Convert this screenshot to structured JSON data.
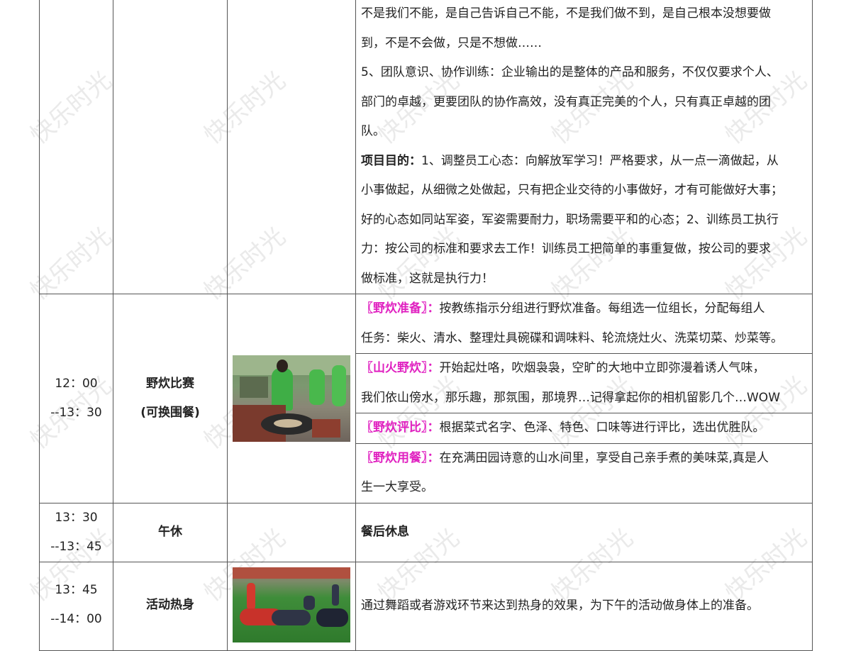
{
  "watermark": "快乐时光",
  "rows": [
    {
      "continuation": true,
      "lines": [
        {
          "segments": [
            {
              "t": "不是我们不能，是自己告诉自己不能，不是我们做不到，是自己根本没想要做"
            }
          ]
        },
        {
          "segments": [
            {
              "t": "到，不是不会做，只是不想做……"
            }
          ]
        },
        {
          "segments": [
            {
              "t": "5、团队意识、协作训练：企业输出的是整体的产品和服务，不仅仅要求个人、"
            }
          ]
        },
        {
          "segments": [
            {
              "t": "部门的卓越，更要团队的协作高效，没有真正完美的个人，只有真正卓越的团"
            }
          ]
        },
        {
          "segments": [
            {
              "t": "队。"
            }
          ]
        },
        {
          "segments": [
            {
              "t": "项目目的：",
              "b": true
            },
            {
              "t": "1、调整员工心态：向解放军学习！严格要求，从一点一滴做起，从"
            }
          ]
        },
        {
          "segments": [
            {
              "t": "小事做起，从细微之处做起，只有把企业交待的小事做好，才有可能做好大事；"
            }
          ]
        },
        {
          "segments": [
            {
              "t": "好的心态如同站军姿，军姿需要耐力，职场需要平和的心态；2、训练员工执行"
            }
          ]
        },
        {
          "segments": [
            {
              "t": "力：按公司的标准和要求去工作！训练员工把简单的事重复做，按公司的要求"
            }
          ]
        },
        {
          "segments": [
            {
              "t": "做标准，这就是执行力！"
            }
          ]
        }
      ]
    },
    {
      "time": [
        "12：00",
        "--13：30"
      ],
      "name": [
        "野炊比赛",
        "(可换围餐)"
      ],
      "image": "cooking-photo",
      "subs": [
        {
          "label": "〖野炊准备〗：",
          "lines": [
            "按教练指示分组进行野炊准备。每组选一位组长，分配每组人",
            "任务：柴火、清水、整理灶具碗碟和调味料、轮流烧灶火、洗菜切菜、炒菜等。"
          ]
        },
        {
          "label": "〖山火野炊〗：",
          "lines": [
            "开始起灶咯，吹烟袅袅，空旷的大地中立即弥漫着诱人气味，",
            "我们依山傍水，那乐趣，那氛围，那境界…记得拿起你的相机留影几个…WOW"
          ]
        },
        {
          "label": "〖野炊评比〗：",
          "lines": [
            "根据菜式名字、色泽、特色、口味等进行评比，选出优胜队。"
          ]
        },
        {
          "label": "〖野炊用餐〗：",
          "lines": [
            "在充满田园诗意的山水间里，享受自己亲手煮的美味菜,真是人",
            "生一大享受。"
          ]
        }
      ]
    },
    {
      "time": [
        "13：30",
        "--13：45"
      ],
      "name": [
        "午休"
      ],
      "desc": "餐后休息"
    },
    {
      "time": [
        "13：45",
        "--14：00"
      ],
      "name": [
        "活动热身"
      ],
      "image": "warmup-photo",
      "desc": "通过舞蹈或者游戏环节来达到热身的效果，为下午的活动做身体上的准备。"
    }
  ]
}
